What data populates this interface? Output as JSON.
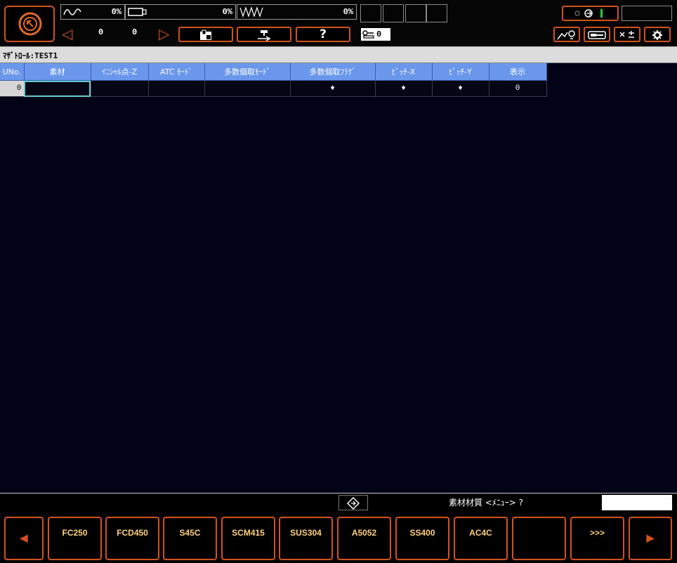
{
  "header": {
    "load_meter_pct": "0%",
    "spindle_meter_pct": "0%",
    "feed_meter_pct": "0%",
    "counter_a": "0",
    "counter_b": "0",
    "help_label": "?",
    "part_counter": "0"
  },
  "title": "ﾏｻﾞﾄﾛｰﾙ:TEST1",
  "table": {
    "columns": [
      "UNo.",
      "素材",
      "ｲﾆｼｬﾙ点-Z",
      "ATC ﾓｰﾄﾞ",
      "多数個取ﾓｰﾄﾞ",
      "多数個取ﾌﾗｸﾞ",
      "ﾋﾟｯﾁ-X",
      "ﾋﾟｯﾁ-Y",
      "表示"
    ],
    "rows": [
      {
        "uno": "0",
        "material": "",
        "initial_z": "",
        "atc_mode": "",
        "multi_mode": "",
        "multi_flag": "♦",
        "pitch_x": "♦",
        "pitch_y": "♦",
        "display": "0"
      }
    ]
  },
  "prompt": {
    "text": "素材材質 <ﾒﾆｭｰ> ?",
    "input_value": ""
  },
  "softkeys": {
    "prev": "◀",
    "items": [
      "FC250",
      "FCD450",
      "S45C",
      "SCM415",
      "SUS304",
      "A5052",
      "SS400",
      "AC4C",
      ""
    ],
    "more": ">>>",
    "next": "▶"
  },
  "colors": {
    "accent": "#d2521c",
    "header_blue": "#6a96ec",
    "background": "#030318",
    "softkey_text": "#ffd27a"
  }
}
